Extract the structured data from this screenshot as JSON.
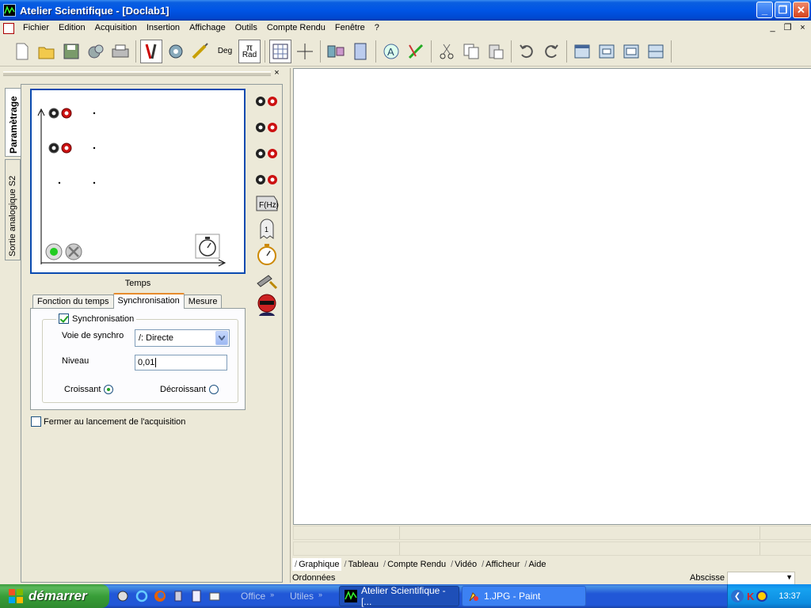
{
  "window": {
    "title": "Atelier Scientifique - [Doclab1]",
    "min_label": "_",
    "max_label": "❐",
    "close_label": "✕"
  },
  "menu": {
    "items": [
      "Fichier",
      "Edition",
      "Acquisition",
      "Insertion",
      "Affichage",
      "Outils",
      "Compte Rendu",
      "Fenêtre",
      "?"
    ],
    "mdi_min": "_",
    "mdi_restore": "❐",
    "mdi_close": "×"
  },
  "toolbar": {
    "deg_label": "Deg",
    "pi_label": "π",
    "rad_label": "Rad"
  },
  "left_panel": {
    "close_label": "×",
    "vtabs": [
      "Paramètrage",
      "Sortie analogique S2"
    ],
    "graph_label": "Temps",
    "tabs": [
      "Fonction du temps",
      "Synchronisation",
      "Mesure"
    ],
    "sync": {
      "checkbox_label": "Synchronisation",
      "checked": true,
      "voie_label": "Voie de synchro",
      "voie_value": "/: Directe",
      "niveau_label": "Niveau",
      "niveau_value": "0,01",
      "croissant_label": "Croissant",
      "decroissant_label": "Décroissant",
      "selected": "Croissant"
    },
    "close_on_start_label": "Fermer au lancement de l'acquisition"
  },
  "main": {
    "bottom_tabs": [
      "Graphique",
      "Tableau",
      "Compte Rendu",
      "Vidéo",
      "Afficheur",
      "Aide"
    ],
    "active_tab": "Graphique"
  },
  "statusbar": {
    "ordonnees": "Ordonnées",
    "abscisse": "Abscisse"
  },
  "taskbar": {
    "start_label": "démarrer",
    "groups": [
      "Office",
      "Utiles"
    ],
    "tasks": [
      "Atelier Scientifique - [...",
      "1.JPG - Paint"
    ],
    "clock": "13:37"
  },
  "colors": {
    "title_blue": "#0055e5",
    "start_green": "#389e38",
    "jack_red": "#cc1111",
    "tab_orange": "#e68b2c"
  }
}
